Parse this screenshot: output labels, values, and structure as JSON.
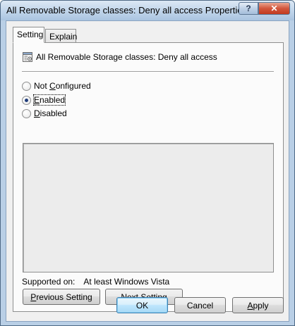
{
  "window": {
    "title": "All Removable Storage classes: Deny all access Properties",
    "help_glyph": "?",
    "close_glyph": "✕"
  },
  "tabs": [
    {
      "label": "Setting",
      "active": true
    },
    {
      "label": "Explain",
      "active": false
    }
  ],
  "policy": {
    "title": "All Removable Storage classes: Deny all access",
    "icon": "policy-document-icon"
  },
  "options": {
    "not_configured": {
      "prefix": "Not ",
      "ul": "C",
      "rest": "onfigured",
      "checked": false
    },
    "enabled": {
      "prefix": "",
      "ul": "E",
      "rest": "nabled",
      "checked": true
    },
    "disabled": {
      "prefix": "",
      "ul": "D",
      "rest": "isabled",
      "checked": false
    }
  },
  "supported": {
    "label": "Supported on:",
    "value": "At least Windows Vista"
  },
  "nav_buttons": {
    "previous": {
      "ul": "P",
      "rest": "revious Setting"
    },
    "next": {
      "ul": "N",
      "rest": "ext Setting"
    }
  },
  "dialog_buttons": {
    "ok": "OK",
    "cancel": "Cancel",
    "apply": {
      "ul": "A",
      "rest": "pply"
    }
  }
}
